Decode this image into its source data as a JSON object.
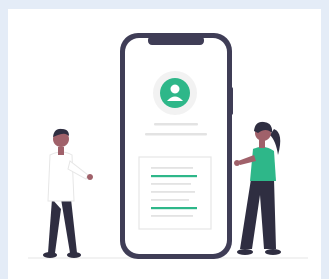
{
  "illustration": {
    "theme": "profile-phone-mockup",
    "colors": {
      "background": "#e4ecf7",
      "card": "#ffffff",
      "phone_frame": "#3f3d56",
      "screen": "#ffffff",
      "accent": "#2eb789",
      "line_gray": "#e3e3e3",
      "skin": "#a0616a",
      "hair": "#2f2e41",
      "pants": "#2f2e41",
      "shirt_man": "#ffffff",
      "shirt_woman": "#2eb789"
    },
    "icons": {
      "profile": "user-avatar-icon"
    }
  }
}
